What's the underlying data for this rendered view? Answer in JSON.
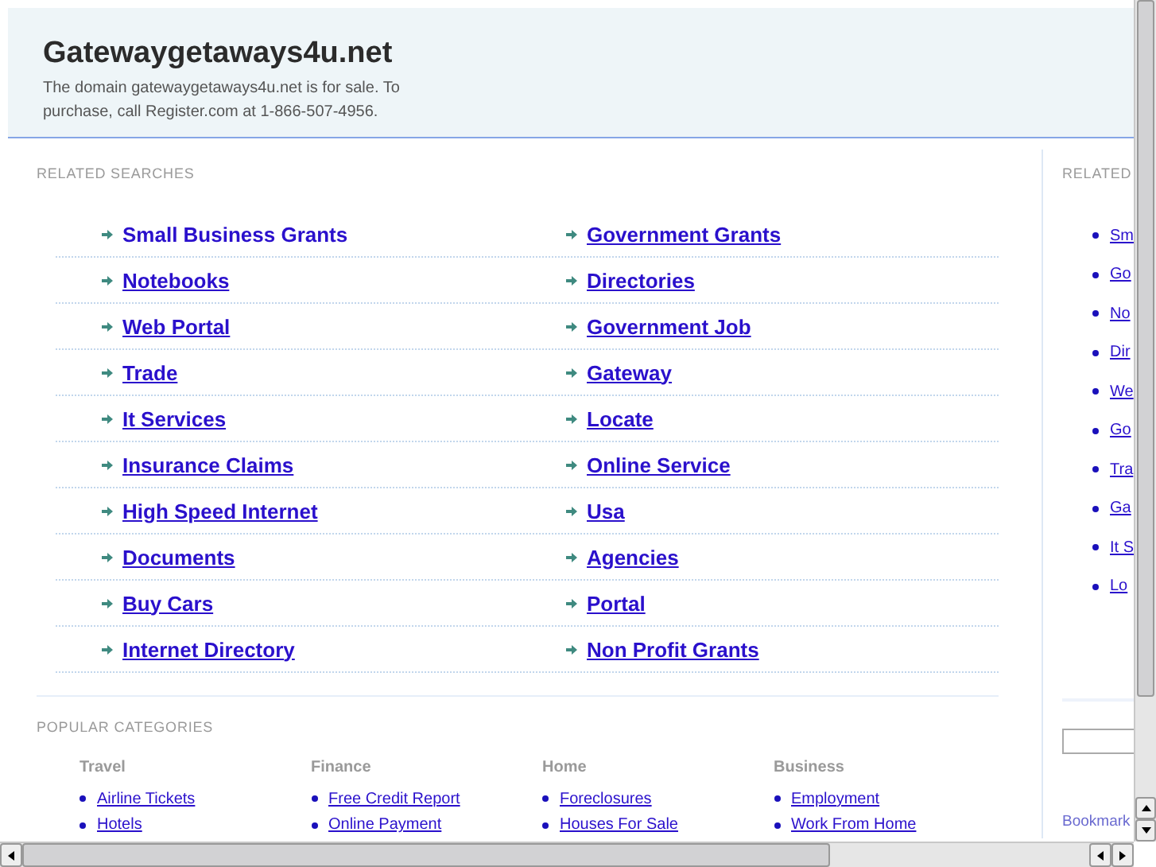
{
  "header": {
    "title": "Gatewaygetaways4u.net",
    "description": "The domain gatewaygetaways4u.net is for sale. To purchase, call Register.com at 1-866-507-4956."
  },
  "related_searches": {
    "heading": "RELATED SEARCHES",
    "columns": [
      {
        "links": [
          {
            "text": "Small Business Grants",
            "underlined": false
          },
          {
            "text": "Notebooks",
            "underlined": true
          },
          {
            "text": "Web Portal",
            "underlined": true
          },
          {
            "text": "Trade",
            "underlined": true
          },
          {
            "text": "It Services",
            "underlined": true
          },
          {
            "text": "Insurance Claims",
            "underlined": true
          },
          {
            "text": "High Speed Internet",
            "underlined": true
          },
          {
            "text": "Documents",
            "underlined": true
          },
          {
            "text": "Buy Cars",
            "underlined": true
          },
          {
            "text": "Internet Directory",
            "underlined": true
          }
        ]
      },
      {
        "links": [
          {
            "text": "Government Grants",
            "underlined": true
          },
          {
            "text": "Directories",
            "underlined": true
          },
          {
            "text": "Government Job",
            "underlined": true
          },
          {
            "text": "Gateway",
            "underlined": true
          },
          {
            "text": "Locate",
            "underlined": true
          },
          {
            "text": "Online Service",
            "underlined": true
          },
          {
            "text": "Usa",
            "underlined": true
          },
          {
            "text": "Agencies",
            "underlined": true
          },
          {
            "text": "Portal",
            "underlined": true
          },
          {
            "text": "Non Profit Grants",
            "underlined": true
          }
        ]
      }
    ]
  },
  "popular_categories": {
    "heading": "POPULAR CATEGORIES",
    "groups": [
      {
        "title": "Travel",
        "links": [
          "Airline Tickets",
          "Hotels"
        ]
      },
      {
        "title": "Finance",
        "links": [
          "Free Credit Report",
          "Online Payment"
        ]
      },
      {
        "title": "Home",
        "links": [
          "Foreclosures",
          "Houses For Sale"
        ]
      },
      {
        "title": "Business",
        "links": [
          "Employment",
          "Work From Home"
        ]
      }
    ]
  },
  "sidebar": {
    "heading": "RELATED",
    "links": [
      "Sm",
      "Go",
      "No",
      "Dir",
      "We",
      "Go",
      "Tra",
      "Ga",
      "It S",
      "Lo"
    ],
    "bookmark": "Bookmark"
  }
}
